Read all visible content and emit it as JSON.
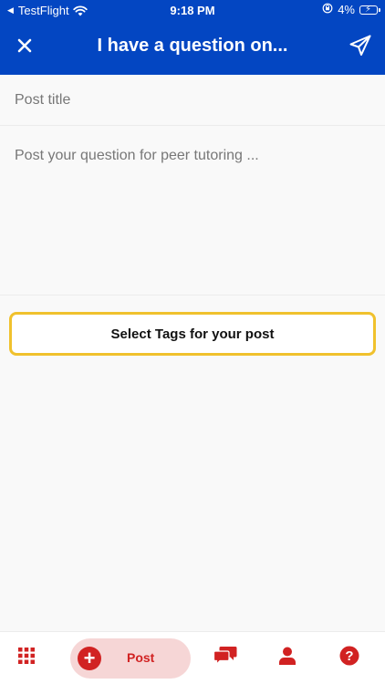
{
  "status_bar": {
    "back_app": "TestFlight",
    "time": "9:18 PM",
    "battery": "4%"
  },
  "nav": {
    "title": "I have a question on...",
    "close_icon": "close-icon",
    "send_icon": "send-icon"
  },
  "form": {
    "title_placeholder": "Post title",
    "title_value": "",
    "body_placeholder": "Post your question for peer tutoring ...",
    "body_value": "",
    "tags_button_label": "Select Tags for your post"
  },
  "bottom_nav": {
    "post_label": "Post",
    "icons": [
      "grid-menu-icon",
      "plus-icon",
      "chat-icon",
      "profile-icon",
      "help-icon"
    ]
  },
  "colors": {
    "header_blue": "#0346c2",
    "accent_red": "#d12222",
    "pill_bg": "#f6d6d6",
    "tags_border": "#f0c12d"
  }
}
